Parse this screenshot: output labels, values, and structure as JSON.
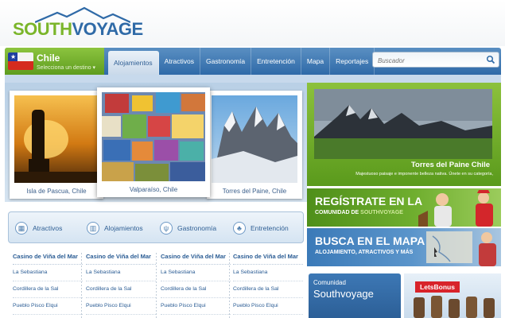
{
  "site": {
    "logo_south": "SOUTH",
    "logo_voyage": "VOYAGE"
  },
  "country": {
    "name": "Chile",
    "sub": "Selecciona un destino ▾"
  },
  "nav": {
    "tabs": [
      "Alojamientos",
      "Atractivos",
      "Gastronomía",
      "Entretención",
      "Mapa",
      "Reportajes"
    ],
    "active": "Alojamientos"
  },
  "search": {
    "placeholder": "Buscador"
  },
  "gallery": [
    {
      "caption": "Isla de Pascua, Chile"
    },
    {
      "caption": "Valparaíso, Chile"
    },
    {
      "caption": "Torres del Paine, Chile"
    }
  ],
  "feature": {
    "title": "Torres del Paine Chile",
    "desc": "Majestuoso paisaje e imponente belleza nativa. Únete en su categoría,"
  },
  "banners": [
    {
      "big": "REGÍSTRATE EN LA",
      "small_a": "COMUNIDAD DE ",
      "small_b": "SOUTHVOYAGE"
    },
    {
      "big": "BUSCA EN EL MAPA",
      "small_a": "ALOJAMIENTO, ATRACTIVOS Y MÁS",
      "small_b": ""
    }
  ],
  "community": {
    "t1": "Comunidad",
    "t2": "Southvoyage"
  },
  "letsbonus": {
    "label": "LetsBonus"
  },
  "categories": [
    "Atractivos",
    "Alojamientos",
    "Gastronomía",
    "Entretención"
  ],
  "columns": [
    {
      "title": "Casino de Viña del Mar",
      "items": [
        "La Sebastiana",
        "Cordillera de la Sal",
        "Pueblo Pisco Elqui"
      ]
    },
    {
      "title": "Casino de Viña del Mar",
      "items": [
        "La Sebastiana",
        "Cordillera de la Sal",
        "Pueblo Pisco Elqui"
      ]
    },
    {
      "title": "Casino de Viña del Mar",
      "items": [
        "La Sebastiana",
        "Cordillera de la Sal",
        "Pueblo Pisco Elqui"
      ]
    },
    {
      "title": "Casino de Viña del Mar",
      "items": [
        "La Sebastiana",
        "Cordillera de la Sal",
        "Pueblo Pisco Elqui"
      ]
    }
  ]
}
